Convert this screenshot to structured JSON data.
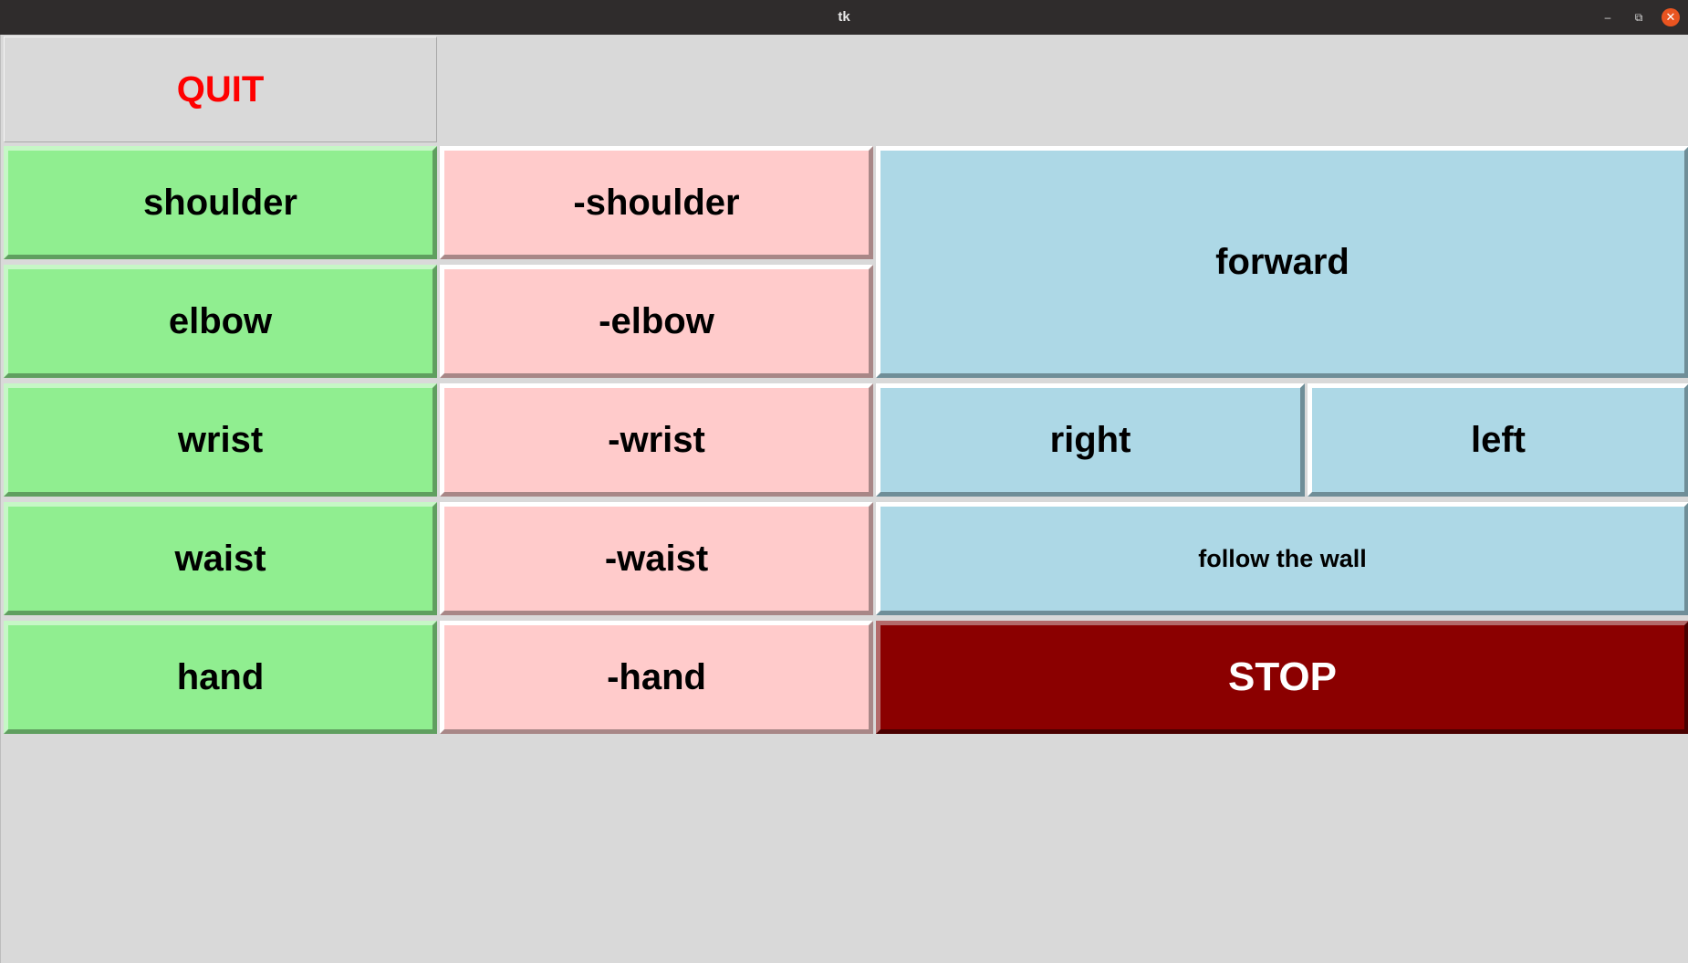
{
  "window": {
    "title": "tk",
    "controls": {
      "minimize_glyph": "–",
      "maximize_glyph": "⧉",
      "close_glyph": "✕"
    }
  },
  "colors": {
    "joint_positive": "#90ee90",
    "joint_negative": "#ffcbcb",
    "drive": "#add8e6",
    "stop": "#8b0000",
    "quit_text": "#ff0000",
    "background": "#d9d9d9"
  },
  "buttons": {
    "quit": "QUIT",
    "shoulder": "shoulder",
    "elbow": "elbow",
    "wrist": "wrist",
    "waist": "waist",
    "hand": "hand",
    "neg_shoulder": "-shoulder",
    "neg_elbow": "-elbow",
    "neg_wrist": "-wrist",
    "neg_waist": "-waist",
    "neg_hand": "-hand",
    "forward": "forward",
    "right": "right",
    "left": "left",
    "follow_wall": "follow the wall",
    "stop": "STOP"
  }
}
